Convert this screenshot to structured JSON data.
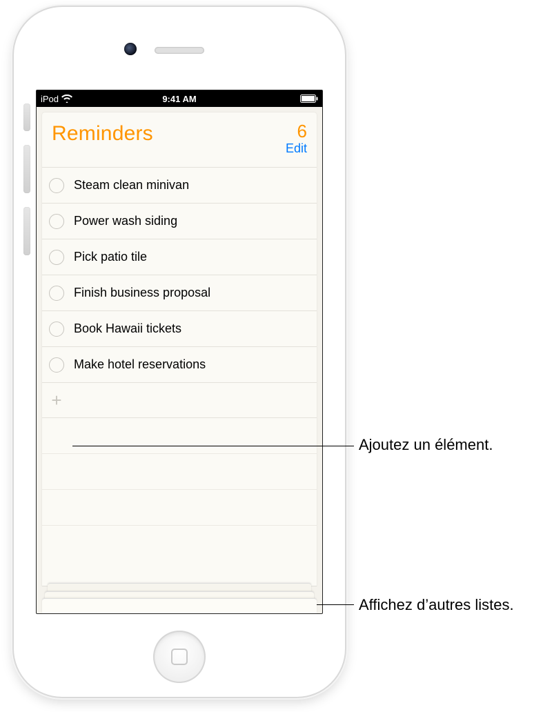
{
  "status_bar": {
    "carrier": "iPod",
    "time": "9:41 AM"
  },
  "header": {
    "title": "Reminders",
    "count": "6",
    "edit_label": "Edit"
  },
  "items": [
    {
      "label": "Steam clean minivan"
    },
    {
      "label": "Power wash siding"
    },
    {
      "label": "Pick patio tile"
    },
    {
      "label": "Finish business proposal"
    },
    {
      "label": "Book Hawaii tickets"
    },
    {
      "label": "Make hotel reservations"
    }
  ],
  "callouts": {
    "add_item": "Ajoutez un élément.",
    "other_lists": "Affichez d’autres listes."
  }
}
